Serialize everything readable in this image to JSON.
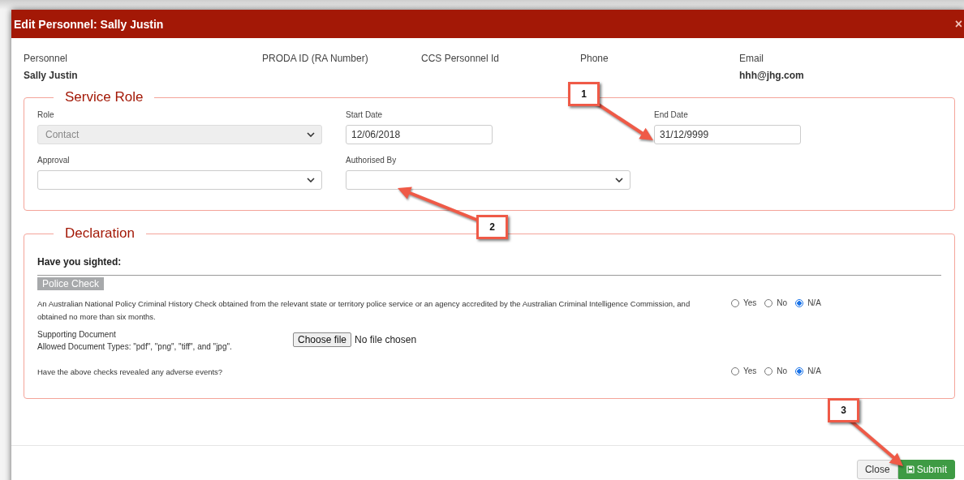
{
  "window": {
    "title": "Edit Personnel: Sally Justin",
    "close": "×"
  },
  "summary": [
    {
      "label": "Personnel",
      "value": "Sally Justin"
    },
    {
      "label": "PRODA ID (RA Number)"
    },
    {
      "label": "CCS Personnel Id"
    },
    {
      "label": "Phone"
    },
    {
      "label": "Email",
      "value": "hhh@jhg.com"
    }
  ],
  "service_role": {
    "title": "Service Role",
    "fields": [
      {
        "label": "Role",
        "kind": "select",
        "value": "Contact",
        "disabled": true
      },
      {
        "label": "Start Date",
        "kind": "text",
        "value": "12/06/2018",
        "disabled": false
      },
      {
        "label": "End Date",
        "kind": "text",
        "value": "31/12/9999",
        "disabled": false
      },
      {
        "label": "Approval",
        "kind": "select",
        "disabled": false
      },
      {
        "label": "Authorised By",
        "kind": "select",
        "disabled": false
      }
    ]
  },
  "declaration": {
    "title": "Declaration",
    "heading": "Have you sighted:",
    "section": "Police Check",
    "items": [
      {
        "kind": "question",
        "text": "An Australian National Policy Criminal History Check obtained from the relevant state or territory police service or an agency accredited by the Australian Criminal Intelligence Commission, and obtained no more than six months.",
        "options": [
          {
            "label": "Yes",
            "selected": false
          },
          {
            "label": "No",
            "selected": false
          },
          {
            "label": "N/A",
            "selected": true
          }
        ]
      },
      {
        "kind": "upload",
        "label": "Supporting Document",
        "hint": "Allowed Document Types: \"pdf\", \"png\", \"tiff\", and \"jpg\".",
        "button": "Choose file",
        "status": "No file chosen"
      },
      {
        "kind": "question",
        "text": "Have the above checks revealed any adverse events?",
        "options": [
          {
            "label": "Yes",
            "selected": false
          },
          {
            "label": "No",
            "selected": false
          },
          {
            "label": "N/A",
            "selected": true
          }
        ]
      }
    ]
  },
  "footer": {
    "buttons": [
      {
        "label": "Close",
        "kind": "default"
      },
      {
        "label": "Submit",
        "kind": "primary"
      }
    ]
  },
  "callouts": [
    "1",
    "2",
    "3"
  ]
}
